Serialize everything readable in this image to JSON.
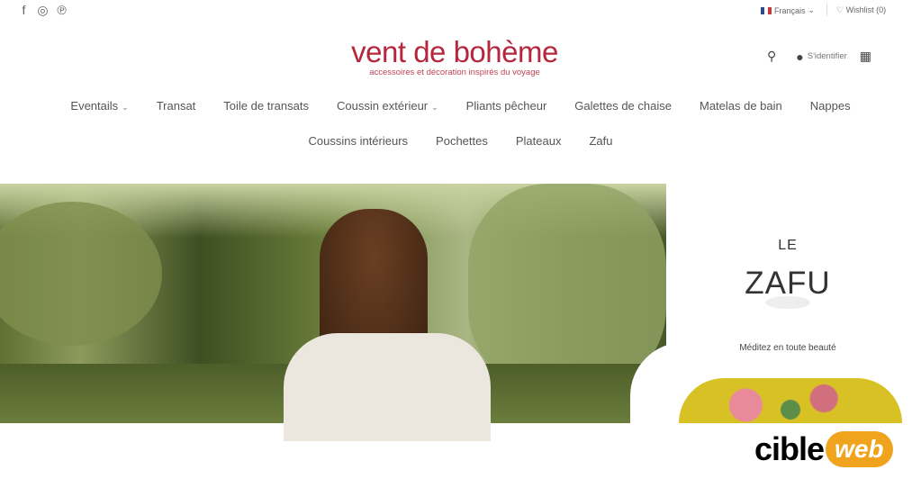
{
  "topbar": {
    "social_icons": [
      "facebook-icon",
      "instagram-icon",
      "pinterest-icon"
    ],
    "social_glyphs": [
      "f",
      "◎",
      "℗"
    ],
    "language": "Français",
    "wishlist": "Wishlist (0)"
  },
  "header": {
    "logo_name": "vent de bohème",
    "logo_tagline": "accessoires et décoration inspirés du voyage",
    "login_label": "S'identifier"
  },
  "nav": {
    "row1": [
      "Eventails",
      "Transat",
      "Toile de transats",
      "Coussin extérieur",
      "Pliants pêcheur",
      "Galettes de chaise",
      "Matelas de bain",
      "Nappes"
    ],
    "row2": [
      "Coussins intérieurs",
      "Pochettes",
      "Plateaux",
      "Zafu"
    ]
  },
  "promo": {
    "line1": "LE",
    "line2": "ZAFU",
    "subtitle": "Méditez en toute beauté"
  },
  "badge": {
    "part1": "cible",
    "part2": "web"
  },
  "colors": {
    "brand": "#b5273d",
    "badge_orange": "#f0a41e"
  }
}
